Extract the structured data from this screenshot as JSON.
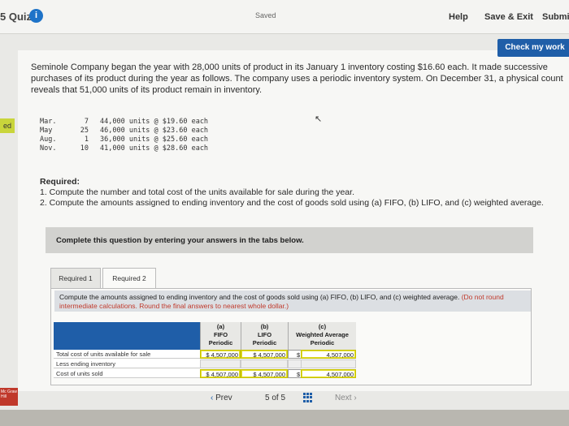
{
  "header": {
    "quiz_title": "5 Quiz",
    "info_icon": "i",
    "saved": "Saved",
    "help": "Help",
    "save_exit": "Save & Exit",
    "submit": "Submit"
  },
  "check_button": "Check my work",
  "problem_text": "Seminole Company began the year with 28,000 units of product in its January 1 inventory costing $16.60 each. It made successive purchases of its product during the year as follows. The company uses a periodic inventory system. On December 31, a physical count reveals that 51,000 units of its product remain in inventory.",
  "purchases": [
    {
      "month": "Mar.",
      "day": "7",
      "detail": "44,000 units @ $19.60 each"
    },
    {
      "month": "May",
      "day": "25",
      "detail": "46,000 units @ $23.60 each"
    },
    {
      "month": "Aug.",
      "day": "1",
      "detail": "36,000 units @ $25.60 each"
    },
    {
      "month": "Nov.",
      "day": "10",
      "detail": "41,000 units @ $28.60 each"
    }
  ],
  "required": {
    "heading": "Required:",
    "item1": "1. Compute the number and total cost of the units available for sale during the year.",
    "item2": "2. Compute the amounts assigned to ending inventory and the cost of goods sold using (a) FIFO, (b) LIFO, and (c) weighted average."
  },
  "instruction_banner": "Complete this question by entering your answers in the tabs below.",
  "tabs": [
    {
      "label": "Required 1"
    },
    {
      "label": "Required 2"
    }
  ],
  "tab_instruction": {
    "main": "Compute the amounts assigned to ending inventory and the cost of goods sold using (a) FIFO, (b) LIFO, and (c) weighted average.",
    "note": "(Do not round intermediate calculations. Round the final answers to nearest whole dollar.)"
  },
  "table": {
    "col_a": {
      "l1": "(a)",
      "l2": "FIFO",
      "l3": "Periodic"
    },
    "col_b": {
      "l1": "(b)",
      "l2": "LIFO",
      "l3": "Periodic"
    },
    "col_c": {
      "l1": "(c)",
      "l2": "Weighted Average",
      "l3": "Periodic"
    },
    "rows": [
      {
        "label": "Total cost of units available for sale",
        "a": "$ 4,507,000",
        "b": "$ 4,507,000",
        "c_sign": "$",
        "c": "4,507,000"
      },
      {
        "label": "Less ending inventory",
        "a": "",
        "b": "",
        "c_sign": "",
        "c": ""
      },
      {
        "label": "Cost of units sold",
        "a": "$ 4,507,000",
        "b": "$ 4,507,000",
        "c_sign": "$",
        "c": "4,507,000"
      }
    ]
  },
  "nav": {
    "prev": "Prev",
    "page": "5 of 5",
    "next": "Next",
    "prev_icon": "chevron-left-icon",
    "next_icon": "chevron-right-icon",
    "grid_icon": "grid-icon"
  },
  "logo_text": "Mc Graw Hill",
  "side_tab": "ed",
  "colors": {
    "accent": "#1f5ea8",
    "info": "#1e73c8",
    "red_note": "#c0392b"
  }
}
